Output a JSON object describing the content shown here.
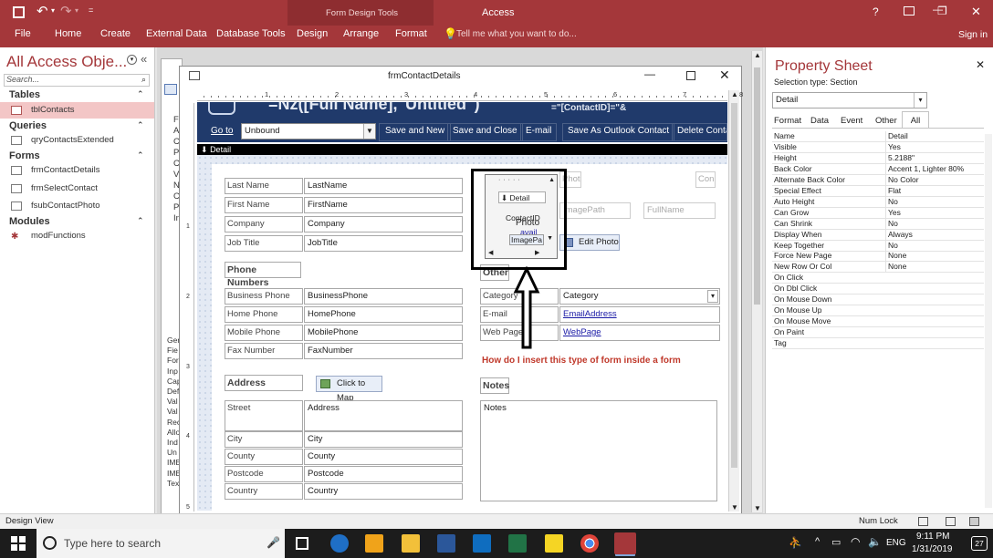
{
  "title_bar": {
    "app_title": "Access",
    "context_group": "Form Design Tools",
    "help": "?",
    "minimize": "—",
    "restore": "❐",
    "close": "✕"
  },
  "ribbon": {
    "tabs": [
      "File",
      "Home",
      "Create",
      "External Data",
      "Database Tools",
      "Design",
      "Arrange",
      "Format"
    ],
    "tell_me": "Tell me what you want to do...",
    "sign_in": "Sign in"
  },
  "nav": {
    "header": "All Access Obje...",
    "search_placeholder": "Search...",
    "groups": {
      "tables": "Tables",
      "queries": "Queries",
      "forms": "Forms",
      "modules": "Modules"
    },
    "items": {
      "tblContacts": "tblContacts",
      "qryContactsExtended": "qryContactsExtended",
      "frmContactDetails": "frmContactDetails",
      "frmSelectContact": "frmSelectContact",
      "fsubContactPhoto": "fsubContactPhoto",
      "modFunctions": "modFunctions"
    }
  },
  "form_window": {
    "title": "frmContactDetails",
    "header_text": "=Nz([Full Name],\"Untitled\")",
    "header_expr_right": "=\"[ContactID]=\"&",
    "goto_label": "Go to",
    "goto_value": "Unbound",
    "buttons": {
      "save_new": "Save and New",
      "save_close": "Save and Close",
      "email": "E-mail",
      "save_outlook": "Save As Outlook Contact",
      "delete": "Delete Contact"
    },
    "detail_bar": "Detail",
    "fields": {
      "last_name_lbl": "Last Name",
      "last_name": "LastName",
      "first_name_lbl": "First Name",
      "first_name": "FirstName",
      "company_lbl": "Company",
      "company": "Company",
      "job_title_lbl": "Job Title",
      "job_title": "JobTitle",
      "phone_numbers": "Phone Numbers",
      "business_phone_lbl": "Business Phone",
      "business_phone": "BusinessPhone",
      "home_phone_lbl": "Home Phone",
      "home_phone": "HomePhone",
      "mobile_phone_lbl": "Mobile Phone",
      "mobile_phone": "MobilePhone",
      "fax_lbl": "Fax Number",
      "fax": "FaxNumber",
      "address_hdr": "Address",
      "click_to_map": "Click to Map",
      "street_lbl": "Street",
      "street": "Address",
      "city_lbl": "City",
      "city": "City",
      "county_lbl": "County",
      "county": "County",
      "postcode_lbl": "Postcode",
      "postcode": "Postcode",
      "country_lbl": "Country",
      "country": "Country",
      "other_hdr": "Other",
      "category_lbl": "Category",
      "category": "Category",
      "email_lbl": "E-mail",
      "email": "EmailAddress",
      "webpage_lbl": "Web Page",
      "webpage": "WebPage",
      "notes_hdr": "Notes",
      "notes": "Notes",
      "image_path": "ImagePath",
      "full_name": "FullName",
      "photo_lbl": "Photo",
      "con_lbl": "Con",
      "edit_photo": "Edit Photo"
    },
    "subform": {
      "detail": "Detail",
      "contact_id": "ContactID",
      "photo": "Photo",
      "avail": "avail",
      "image_path": "ImagePa"
    },
    "annotation": "How do I insert this type of form inside a form"
  },
  "ruler": [
    "1",
    "2",
    "3",
    "4",
    "5",
    "6",
    "7",
    "8"
  ],
  "behind_window_letters": [
    "F",
    "A",
    "C",
    "P",
    "C",
    "V",
    "N",
    "C",
    "P",
    "In"
  ],
  "behind_window_lower": [
    "Ger",
    "Fie",
    "For",
    "Inp",
    "Cap",
    "Def",
    "Val",
    "Val",
    "Rec",
    "Allo",
    "Ind",
    "Un",
    "IME",
    "IME",
    "Tex"
  ],
  "property_sheet": {
    "title": "Property Sheet",
    "selection_type": "Selection type:  Section",
    "selected": "Detail",
    "tabs": [
      "Format",
      "Data",
      "Event",
      "Other",
      "All"
    ],
    "rows": [
      {
        "name": "Name",
        "value": "Detail"
      },
      {
        "name": "Visible",
        "value": "Yes"
      },
      {
        "name": "Height",
        "value": "5.2188\""
      },
      {
        "name": "Back Color",
        "value": "Accent 1, Lighter 80%"
      },
      {
        "name": "Alternate Back Color",
        "value": "No Color"
      },
      {
        "name": "Special Effect",
        "value": "Flat"
      },
      {
        "name": "Auto Height",
        "value": "No"
      },
      {
        "name": "Can Grow",
        "value": "Yes"
      },
      {
        "name": "Can Shrink",
        "value": "No"
      },
      {
        "name": "Display When",
        "value": "Always"
      },
      {
        "name": "Keep Together",
        "value": "No"
      },
      {
        "name": "Force New Page",
        "value": "None"
      },
      {
        "name": "New Row Or Col",
        "value": "None"
      },
      {
        "name": "On Click",
        "value": ""
      },
      {
        "name": "On Dbl Click",
        "value": ""
      },
      {
        "name": "On Mouse Down",
        "value": ""
      },
      {
        "name": "On Mouse Up",
        "value": ""
      },
      {
        "name": "On Mouse Move",
        "value": ""
      },
      {
        "name": "On Paint",
        "value": ""
      },
      {
        "name": "Tag",
        "value": ""
      }
    ]
  },
  "status_bar": {
    "left": "Design View",
    "num_lock": "Num Lock"
  },
  "taskbar": {
    "search_placeholder": "Type here to search",
    "lang": "ENG",
    "time": "9:11 PM",
    "date": "1/31/2019",
    "notifications": "27"
  },
  "colors": {
    "access_red": "#a4373a",
    "context_red": "#8e2d30",
    "form_header_navy": "#203a6b",
    "selected_nav": "#f3c6c6",
    "annotation_red": "#c0392b"
  }
}
